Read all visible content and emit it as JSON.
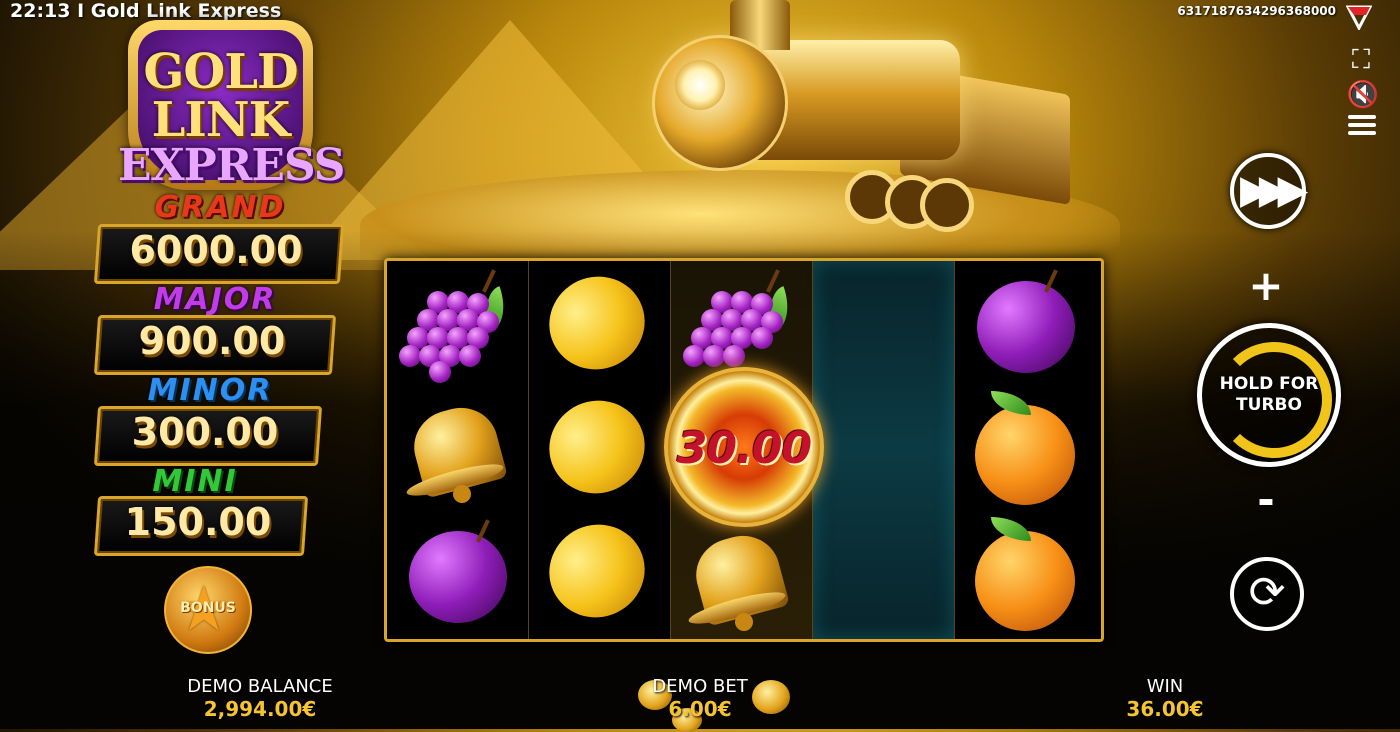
{
  "header": {
    "title": "22:13 I Gold Link Express",
    "game_id": "6317187634296368000"
  },
  "logo": {
    "line1": "GOLD",
    "line2": "LINK",
    "line3": "EXPRESS"
  },
  "jackpots": [
    {
      "name": "GRAND",
      "value": "6000.00",
      "color": "#e8381a"
    },
    {
      "name": "MAJOR",
      "value": "900.00",
      "color": "#c13ce8"
    },
    {
      "name": "MINOR",
      "value": "300.00",
      "color": "#2d8ff0"
    },
    {
      "name": "MINI",
      "value": "150.00",
      "color": "#32c83a"
    }
  ],
  "bonus": {
    "label": "BONUS"
  },
  "controls": {
    "spin_label_line1": "HOLD FOR",
    "spin_label_line2": "TURBO",
    "plus": "+",
    "minus": "-"
  },
  "reels": {
    "columns": [
      [
        "grapes",
        "bell",
        "plum"
      ],
      [
        "lemon",
        "lemon",
        "lemon"
      ],
      [
        "grapes",
        "coin",
        "bell"
      ],
      [],
      [
        "plum",
        "orange",
        "orange"
      ]
    ],
    "coin_value": "30.00"
  },
  "footer": {
    "balance_label": "DEMO BALANCE",
    "balance_value": "2,994.00€",
    "bet_label": "DEMO BET",
    "bet_value": "6.00€",
    "win_label": "WIN",
    "win_value": "36.00€"
  },
  "colors": {
    "accent_gold": "#f6c431",
    "spin_ring": "#f0c419",
    "frame": "#d9a52a"
  }
}
